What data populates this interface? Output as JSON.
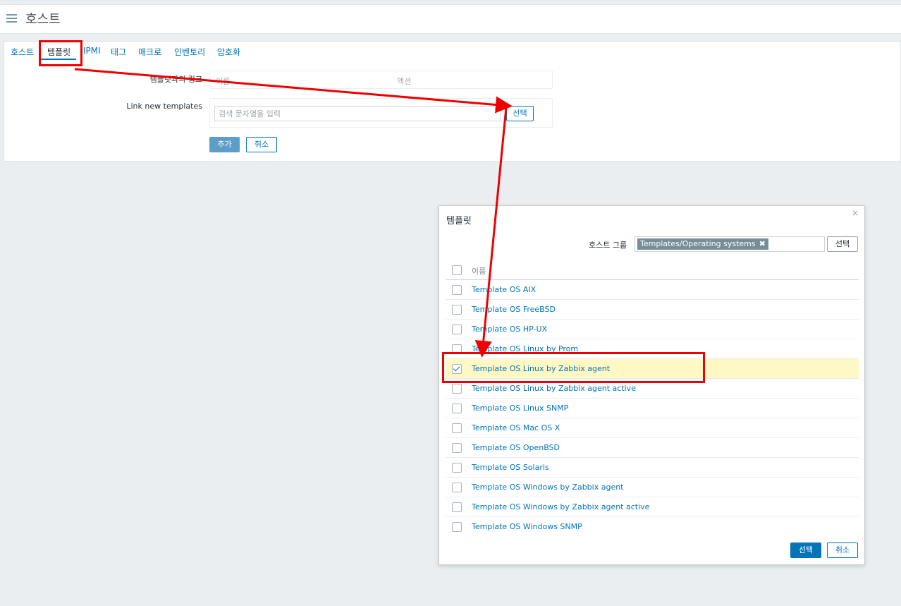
{
  "header": {
    "title": "호스트"
  },
  "tabs": [
    {
      "label": "호스트",
      "active": false
    },
    {
      "label": "템플릿",
      "active": true
    },
    {
      "label": "IPMI",
      "active": false
    },
    {
      "label": "태그",
      "active": false
    },
    {
      "label": "매크로",
      "active": false
    },
    {
      "label": "인벤토리",
      "active": false
    },
    {
      "label": "암호화",
      "active": false
    }
  ],
  "form": {
    "linked_templates_label": "템플릿과의 링크",
    "col_name": "이름",
    "col_action": "액션",
    "link_new_label": "Link new templates",
    "search_placeholder": "검색 문자열을 입력",
    "select_label": "선택",
    "add_label": "추가",
    "cancel_label": "취소"
  },
  "modal": {
    "title": "템플릿",
    "close_icon": "×",
    "host_group_label": "호스트 그룹",
    "host_group_tag": "Templates/Operating systems",
    "tag_remove_icon": "✖",
    "select_label": "선택",
    "column_name": "이름",
    "items": [
      {
        "name": "Template OS AIX",
        "checked": false
      },
      {
        "name": "Template OS FreeBSD",
        "checked": false
      },
      {
        "name": "Template OS HP-UX",
        "checked": false
      },
      {
        "name": "Template OS Linux by Prom",
        "checked": false
      },
      {
        "name": "Template OS Linux by Zabbix agent",
        "checked": true
      },
      {
        "name": "Template OS Linux by Zabbix agent active",
        "checked": false
      },
      {
        "name": "Template OS Linux SNMP",
        "checked": false
      },
      {
        "name": "Template OS Mac OS X",
        "checked": false
      },
      {
        "name": "Template OS OpenBSD",
        "checked": false
      },
      {
        "name": "Template OS Solaris",
        "checked": false
      },
      {
        "name": "Template OS Windows by Zabbix agent",
        "checked": false
      },
      {
        "name": "Template OS Windows by Zabbix agent active",
        "checked": false
      },
      {
        "name": "Template OS Windows SNMP",
        "checked": false
      }
    ],
    "footer_select_label": "선택",
    "footer_cancel_label": "취소"
  },
  "colors": {
    "accent": "#0275b8",
    "highlight_row": "#fef8c5",
    "annotation": "#ee0000"
  }
}
